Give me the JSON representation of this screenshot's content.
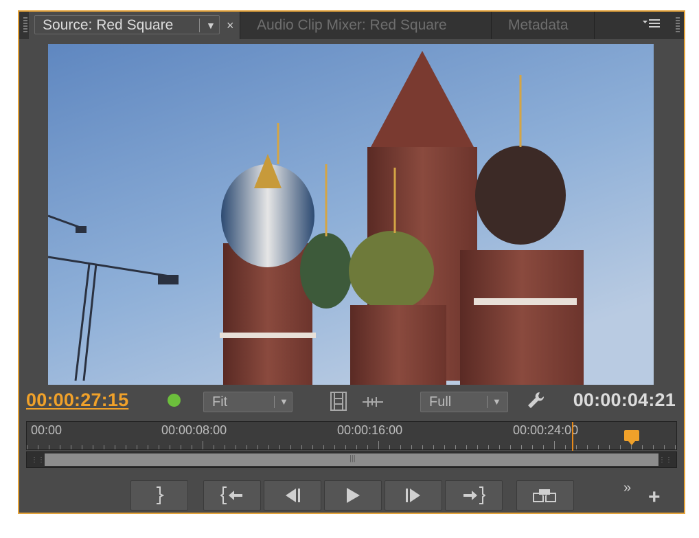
{
  "tabs": [
    {
      "label": "Source: Red Square",
      "active": true
    },
    {
      "label": "Audio Clip Mixer: Red Square",
      "active": false
    },
    {
      "label": "Metadata",
      "active": false
    }
  ],
  "panel_menu_icon": "panel-menu-icon",
  "video": {
    "content": "Saint Basil's Cathedral, Red Square"
  },
  "controls": {
    "playhead_timecode": "00:00:27:15",
    "duration_timecode": "00:00:04:21",
    "zoom_select": "Fit",
    "resolution_select": "Full",
    "status_dot_color": "#6cbf3c",
    "accent_color": "#f0a12a"
  },
  "ruler": {
    "labels": [
      "00:00",
      "00:00:08:00",
      "00:00:16:00",
      "00:00:24:00"
    ]
  },
  "transport": [
    {
      "name": "mark-out-button",
      "icon": "mark-out-icon"
    },
    {
      "name": "go-to-in-button",
      "icon": "go-to-in-icon"
    },
    {
      "name": "step-back-button",
      "icon": "step-back-icon"
    },
    {
      "name": "play-button",
      "icon": "play-icon"
    },
    {
      "name": "step-forward-button",
      "icon": "step-forward-icon"
    },
    {
      "name": "go-to-out-button",
      "icon": "go-to-out-icon"
    },
    {
      "name": "export-frame-button",
      "icon": "export-frame-icon"
    }
  ],
  "extra": {
    "more": "»",
    "add": "+"
  }
}
